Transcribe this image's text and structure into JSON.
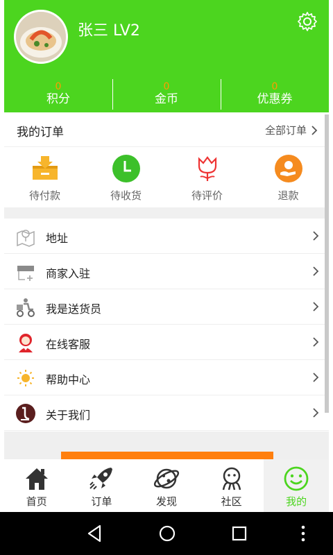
{
  "profile": {
    "username": "张三 LV2"
  },
  "stats": [
    {
      "value": "0",
      "label": "积分"
    },
    {
      "value": "0",
      "label": "金币"
    },
    {
      "value": "0",
      "label": "优惠券"
    }
  ],
  "orders": {
    "title": "我的订单",
    "all_label": "全部订单",
    "items": [
      {
        "label": "待付款",
        "icon": "payment-icon"
      },
      {
        "label": "待收货",
        "icon": "clock-icon"
      },
      {
        "label": "待评价",
        "icon": "flower-icon"
      },
      {
        "label": "退款",
        "icon": "refund-icon"
      }
    ]
  },
  "menu": [
    {
      "label": "地址",
      "icon": "map-icon"
    },
    {
      "label": "商家入驻",
      "icon": "shop-icon"
    },
    {
      "label": "我是送货员",
      "icon": "delivery-icon"
    },
    {
      "label": "在线客服",
      "icon": "support-icon"
    },
    {
      "label": "帮助中心",
      "icon": "bulb-icon"
    },
    {
      "label": "关于我们",
      "icon": "about-icon"
    }
  ],
  "tabs": [
    {
      "label": "首页",
      "icon": "home-icon"
    },
    {
      "label": "订单",
      "icon": "rocket-icon"
    },
    {
      "label": "发现",
      "icon": "planet-icon"
    },
    {
      "label": "社区",
      "icon": "community-icon"
    },
    {
      "label": "我的",
      "icon": "smile-icon",
      "active": true
    }
  ],
  "colors": {
    "brand": "#4cd51f",
    "accent": "#ff9c00",
    "bar": "#ff7f0e"
  }
}
